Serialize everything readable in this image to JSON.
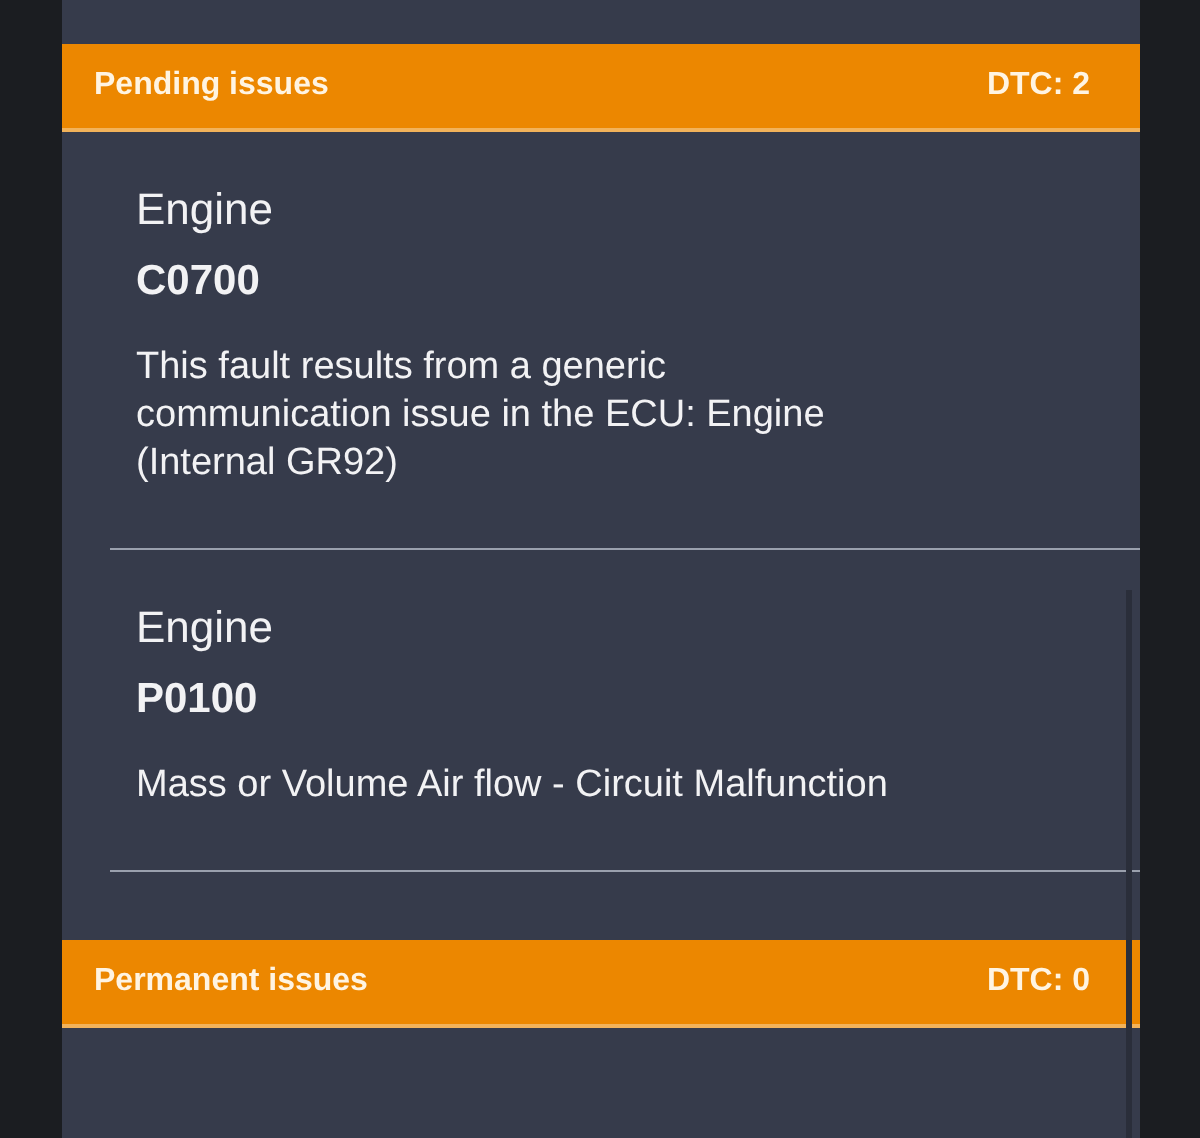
{
  "sections": [
    {
      "title": "Pending issues",
      "count": "DTC: 2",
      "issues": [
        {
          "system": "Engine",
          "code": "C0700",
          "description": "This fault results from a generic communication issue in the ECU: Engine (Internal GR92)"
        },
        {
          "system": "Engine",
          "code": "P0100",
          "description": "Mass or Volume Air flow - Circuit Malfunction"
        }
      ]
    },
    {
      "title": "Permanent issues",
      "count": "DTC: 0"
    }
  ]
}
